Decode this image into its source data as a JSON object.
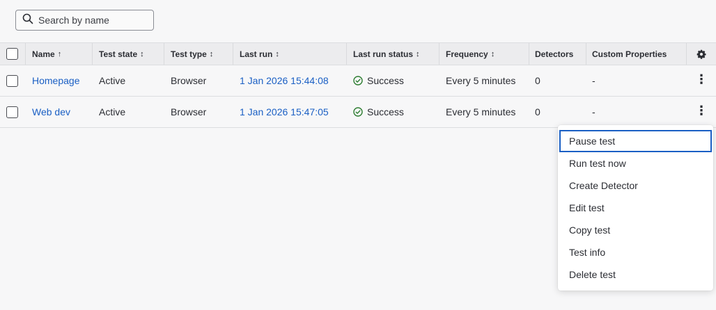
{
  "search": {
    "placeholder": "Search by name"
  },
  "table": {
    "columns": {
      "name": "Name",
      "name_sort": "↑",
      "test_state": "Test state",
      "test_type": "Test type",
      "last_run": "Last run",
      "last_run_status": "Last run status",
      "frequency": "Frequency",
      "detectors": "Detectors",
      "custom_properties": "Custom Properties",
      "sort_both": "↕"
    },
    "rows": [
      {
        "name": "Homepage",
        "test_state": "Active",
        "test_type": "Browser",
        "last_run": "1 Jan 2026 15:44:08",
        "last_run_status": "Success",
        "frequency": "Every 5 minutes",
        "detectors": "0",
        "custom_properties": "-"
      },
      {
        "name": "Web dev",
        "test_state": "Active",
        "test_type": "Browser",
        "last_run": "1 Jan 2026 15:47:05",
        "last_run_status": "Success",
        "frequency": "Every 5 minutes",
        "detectors": "0",
        "custom_properties": "-"
      }
    ]
  },
  "menu": {
    "items": [
      "Pause test",
      "Run test now",
      "Create Detector",
      "Edit test",
      "Copy test",
      "Test info",
      "Delete test"
    ]
  },
  "icons": {
    "search": "search-icon",
    "settings": "gear-icon",
    "status": "check-circle-icon",
    "more": "kebab-menu-icon"
  },
  "colors": {
    "link": "#1a5fc4",
    "success": "#2e7d32",
    "focus": "#1a5fc4"
  }
}
